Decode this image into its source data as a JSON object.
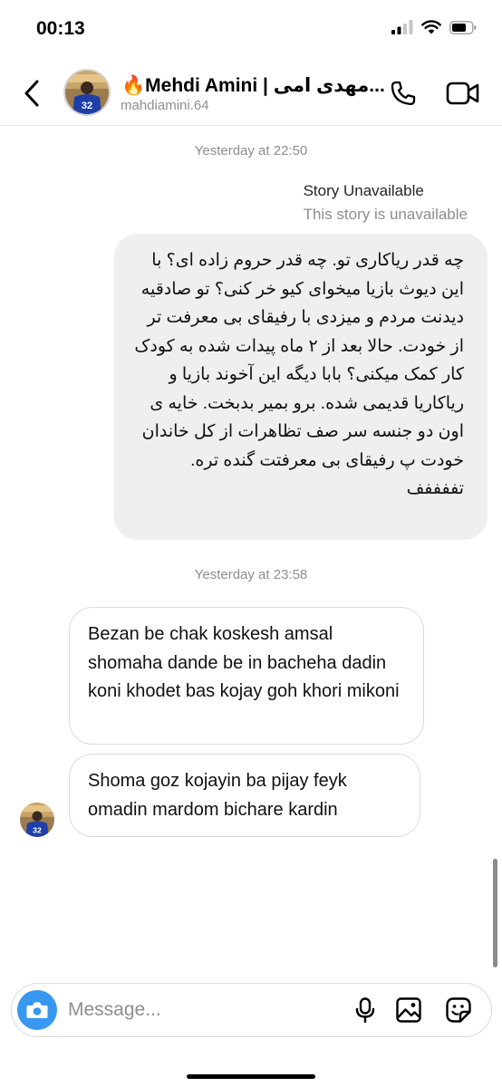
{
  "status_bar": {
    "time": "00:13"
  },
  "header": {
    "name": "🔥Mehdi Amini | مهدی امی...",
    "username": "mahdiamini.64",
    "avatar_jersey": "32"
  },
  "thread": {
    "timestamp_1": "Yesterday at 22:50",
    "story_title": "Story Unavailable",
    "story_subtitle": "This story is unavailable",
    "outgoing_message": "چه قدر ریاکاری تو. چه قدر حروم زاده ای؟ با این دیوث بازیا میخوای کیو خر کنی؟ تو صادقیه دیدنت مردم و میزدی با رفیقای بی معرفت تر از خودت. حالا بعد از ۲ ماه پیدات شده به کودک کار کمک میکنی؟ بابا دیگه این آخوند بازیا و ریاکاریا قدیمی شده. برو بمیر بدبخت. خایه ی اون دو جنسه سر صف تظاهرات از کل خاندان خودت پ رفیقای بی معرفتت گنده تره. تففففف",
    "timestamp_2": "Yesterday at 23:58",
    "incoming_1": "Bezan be chak koskesh amsal shomaha dande be in bacheha dadin koni khodet bas kojay goh khori mikoni",
    "incoming_2": "Shoma goz kojayin ba pijay feyk omadin mardom bichare kardin"
  },
  "composer": {
    "placeholder": "Message..."
  },
  "colors": {
    "accent": "#3897f0",
    "bubble_gray": "#efefef",
    "meta_gray": "#8e8e8e"
  },
  "icons": {
    "status": [
      "signal-icon",
      "wifi-icon",
      "battery-icon"
    ],
    "header": [
      "back-chevron-icon",
      "phone-icon",
      "video-camera-icon"
    ],
    "composer": [
      "camera-icon",
      "microphone-icon",
      "gallery-icon",
      "sticker-icon"
    ]
  }
}
